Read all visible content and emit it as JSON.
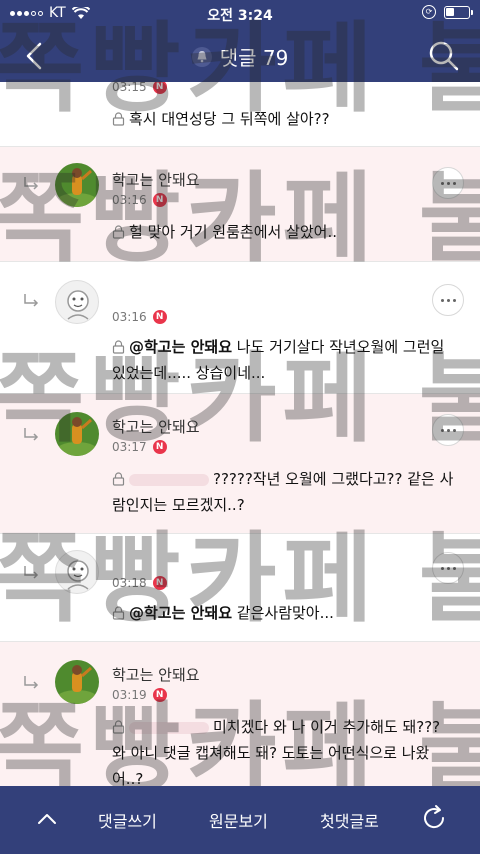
{
  "status_bar": {
    "carrier": "KT",
    "time": "오전 3:24"
  },
  "nav": {
    "title": "댓글 79"
  },
  "comments": [
    {
      "id": "c0",
      "nickname": "",
      "time": "03:15",
      "text": "혹시 대연성당 그 뒤쪽에 살아??",
      "mention": "",
      "secret": true
    },
    {
      "id": "c1",
      "nickname": "학고는 안돼요",
      "time": "03:16",
      "text": "헐 맞아 거기 원룸촌에서 살았어..",
      "mention": "",
      "secret": true
    },
    {
      "id": "c2",
      "nickname": "",
      "time": "03:16",
      "mention": "@학고는 안돼요",
      "text": " 나도 거기살다 작년오월에 그런일있었는데..... 상습이네...",
      "secret": true
    },
    {
      "id": "c3",
      "nickname": "학고는 안돼요",
      "time": "03:17",
      "mention": "",
      "text": "?????작년 오월에 그랬다고?? 같은 사람인지는 모르겠지..?",
      "secret": true
    },
    {
      "id": "c4",
      "nickname": "",
      "time": "03:18",
      "mention": "@학고는 안돼요",
      "text": " 같은사람맞아...",
      "secret": true
    },
    {
      "id": "c5",
      "nickname": "학고는 안돼요",
      "time": "03:19",
      "mention": "",
      "text": "미치겠다 와 나 이거 추가해도 돼??? 와 아니 댓글 캡쳐해도 돼? 도토는 어떤식으로 나왔어..?",
      "secret": true
    }
  ],
  "badge": "N",
  "watermark": {
    "text": "쪽빵카페 불펌 금지"
  },
  "bottom_bar": {
    "write": "댓글쓰기",
    "original": "원문보기",
    "first": "첫댓글로"
  },
  "colors": {
    "header_bg": "#33407a",
    "pink_row": "#fdf1f2",
    "badge": "#e9354b"
  },
  "icons": [
    "back-arrow-icon",
    "bell-icon",
    "search-icon",
    "reply-arrow-icon",
    "lock-icon",
    "more-icon",
    "chevron-up-icon",
    "refresh-icon"
  ]
}
